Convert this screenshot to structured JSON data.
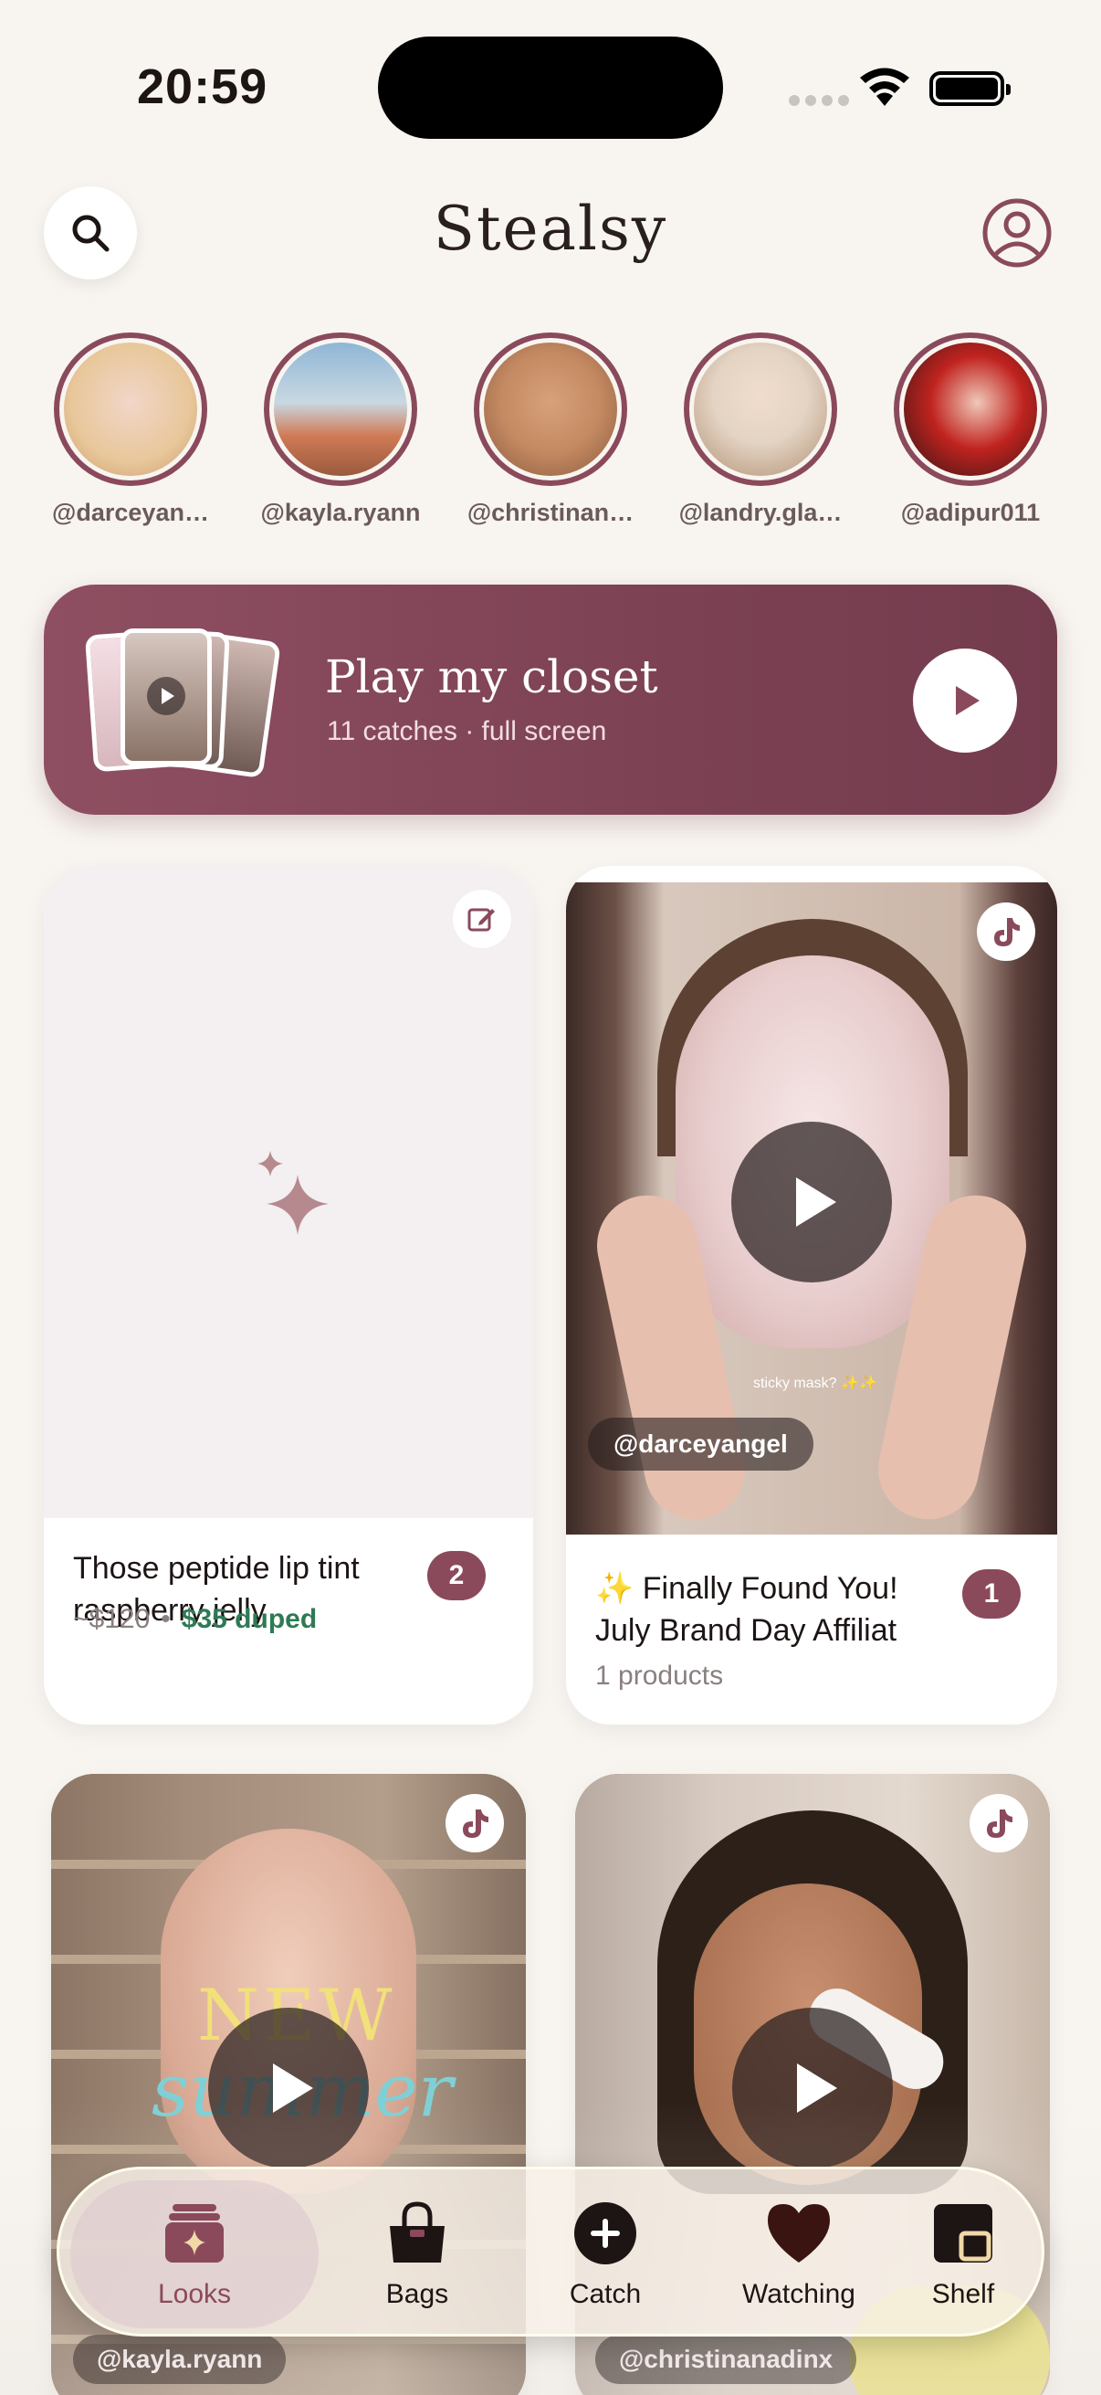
{
  "status_bar": {
    "time": "20:59"
  },
  "header": {
    "title": "Stealsy"
  },
  "stories": [
    {
      "handle": "@darceyan…",
      "colors": [
        "#e8c79a",
        "#f2d6c8"
      ]
    },
    {
      "handle": "@kayla.ryann",
      "colors": [
        "#8fb6d6",
        "#d07a55"
      ]
    },
    {
      "handle": "@christinan…",
      "colors": [
        "#c48a62",
        "#8a5a3e"
      ]
    },
    {
      "handle": "@landry.gla…",
      "colors": [
        "#e4d4c4",
        "#b09072"
      ]
    },
    {
      "handle": "@adipur011",
      "colors": [
        "#c0231f",
        "#2a1414"
      ]
    }
  ],
  "closet_banner": {
    "title": "Play my closet",
    "subtitle": "11 catches · full screen"
  },
  "cards": [
    {
      "title": "Those peptide lip tint raspberry jelly",
      "count": "2",
      "price_original": "~$120",
      "price_separator": "•",
      "price_duped": "$35 duped"
    },
    {
      "title": "✨ Finally Found You! July Brand Day Affiliat",
      "count": "1",
      "meta": "1 products",
      "handle": "@darceyangel",
      "video_caption": "sticky mask? ✨✨"
    },
    {
      "handle": "@kayla.ryann",
      "overlay_line1": "NEW",
      "overlay_line2": "summer"
    },
    {
      "handle": "@christinanadinx"
    }
  ],
  "nav": {
    "items": [
      {
        "label": "Looks",
        "icon": "looks-icon"
      },
      {
        "label": "Bags",
        "icon": "bag-icon"
      },
      {
        "label": "Catch",
        "icon": "plus-circle-icon"
      },
      {
        "label": "Watching",
        "icon": "heart-icon"
      },
      {
        "label": "Shelf",
        "icon": "shelf-icon"
      }
    ]
  },
  "colors": {
    "accent": "#8a4a5c",
    "duped_green": "#2f7a55",
    "background": "#f8f5f0"
  }
}
